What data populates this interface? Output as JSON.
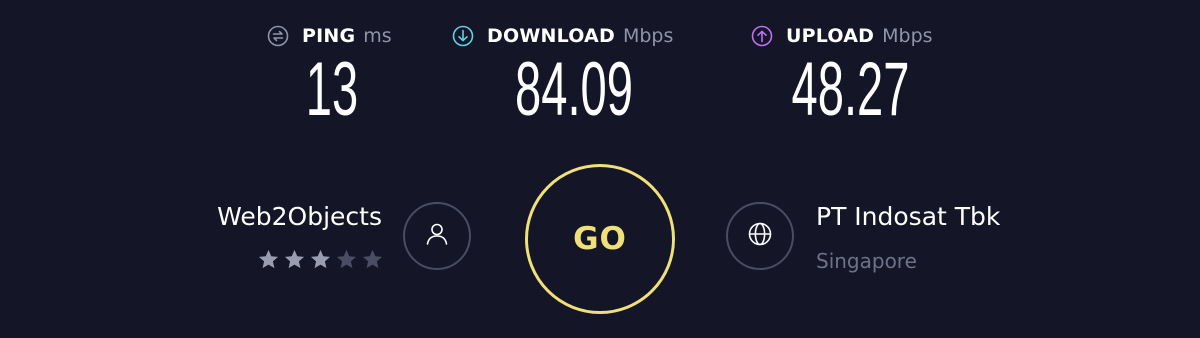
{
  "metrics": {
    "ping": {
      "label": "PING",
      "unit": "ms",
      "value": "13",
      "icon": "ping-icon",
      "icon_color": "#9193a8"
    },
    "download": {
      "label": "DOWNLOAD",
      "unit": "Mbps",
      "value": "84.09",
      "icon": "download-arrow-icon",
      "icon_color": "#5ed3e5"
    },
    "upload": {
      "label": "UPLOAD",
      "unit": "Mbps",
      "value": "48.27",
      "icon": "upload-arrow-icon",
      "icon_color": "#bf71f2"
    }
  },
  "host": {
    "name": "Web2Objects",
    "rating": 3,
    "rating_max": 5,
    "icon": "user-icon"
  },
  "go_button": {
    "label": "GO",
    "color": "#f0e07a"
  },
  "provider": {
    "name": "PT Indosat Tbk",
    "location": "Singapore",
    "icon": "globe-icon"
  },
  "colors": {
    "background": "#141526",
    "text": "#ffffff",
    "muted": "#9193a8",
    "circle_border": "#4a4c63",
    "star_on": "#9a9cb0",
    "star_off": "#4a4c63"
  }
}
